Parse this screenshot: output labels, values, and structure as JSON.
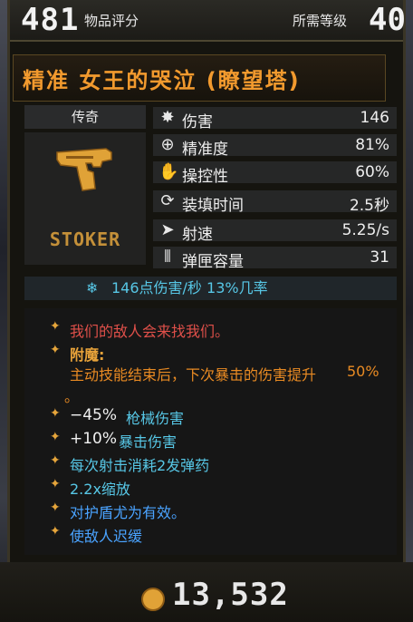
{
  "header": {
    "item_score": "481",
    "item_score_label": "物品评分",
    "required_level_label": "所需等级",
    "required_level": "40"
  },
  "title": "精准 女王的哭泣 (瞭望塔)",
  "rarity": "传奇",
  "manufacturer": "STOKER",
  "stats": [
    {
      "icon": "damage-icon",
      "name": "伤害",
      "value": "146"
    },
    {
      "icon": "accuracy-icon",
      "name": "精准度",
      "value": "81%"
    },
    {
      "icon": "handling-icon",
      "name": "操控性",
      "value": "60%"
    },
    {
      "icon": "reload-icon",
      "name": "装填时间",
      "value": "2.5秒"
    },
    {
      "icon": "fire-rate-icon",
      "name": "射速",
      "value": "5.25/s"
    },
    {
      "icon": "magazine-icon",
      "name": "弹匣容量",
      "value": "31"
    }
  ],
  "dps": {
    "text": "146点伤害/秒  13%几率"
  },
  "notes": {
    "flavor": "我们的敌人会来找我们。",
    "enchant_label": "附魔:",
    "enchant_text": "主动技能结束后，下次暴击的伤害提升",
    "enchant_value": "50%",
    "enchant_end": "。",
    "gun_damage_value": "−45%",
    "gun_damage_label": "枪械伤害",
    "crit_value": "+10%",
    "crit_label": "暴击伤害",
    "ammo_text": "每次射击消耗2发弹药",
    "zoom_text": "2.2x缩放",
    "shield_text": "对护盾尤为有效。",
    "slow_text": "使敌人迟缓"
  },
  "price": "13,532",
  "colors": {
    "legendary_orange": "#f29a2e",
    "flavor_red": "#e0504a",
    "cyan_stat": "#57c7e6",
    "enchant_orange": "#e88a23",
    "blue_text": "#4aa3ff",
    "gold": "#e0a237"
  }
}
